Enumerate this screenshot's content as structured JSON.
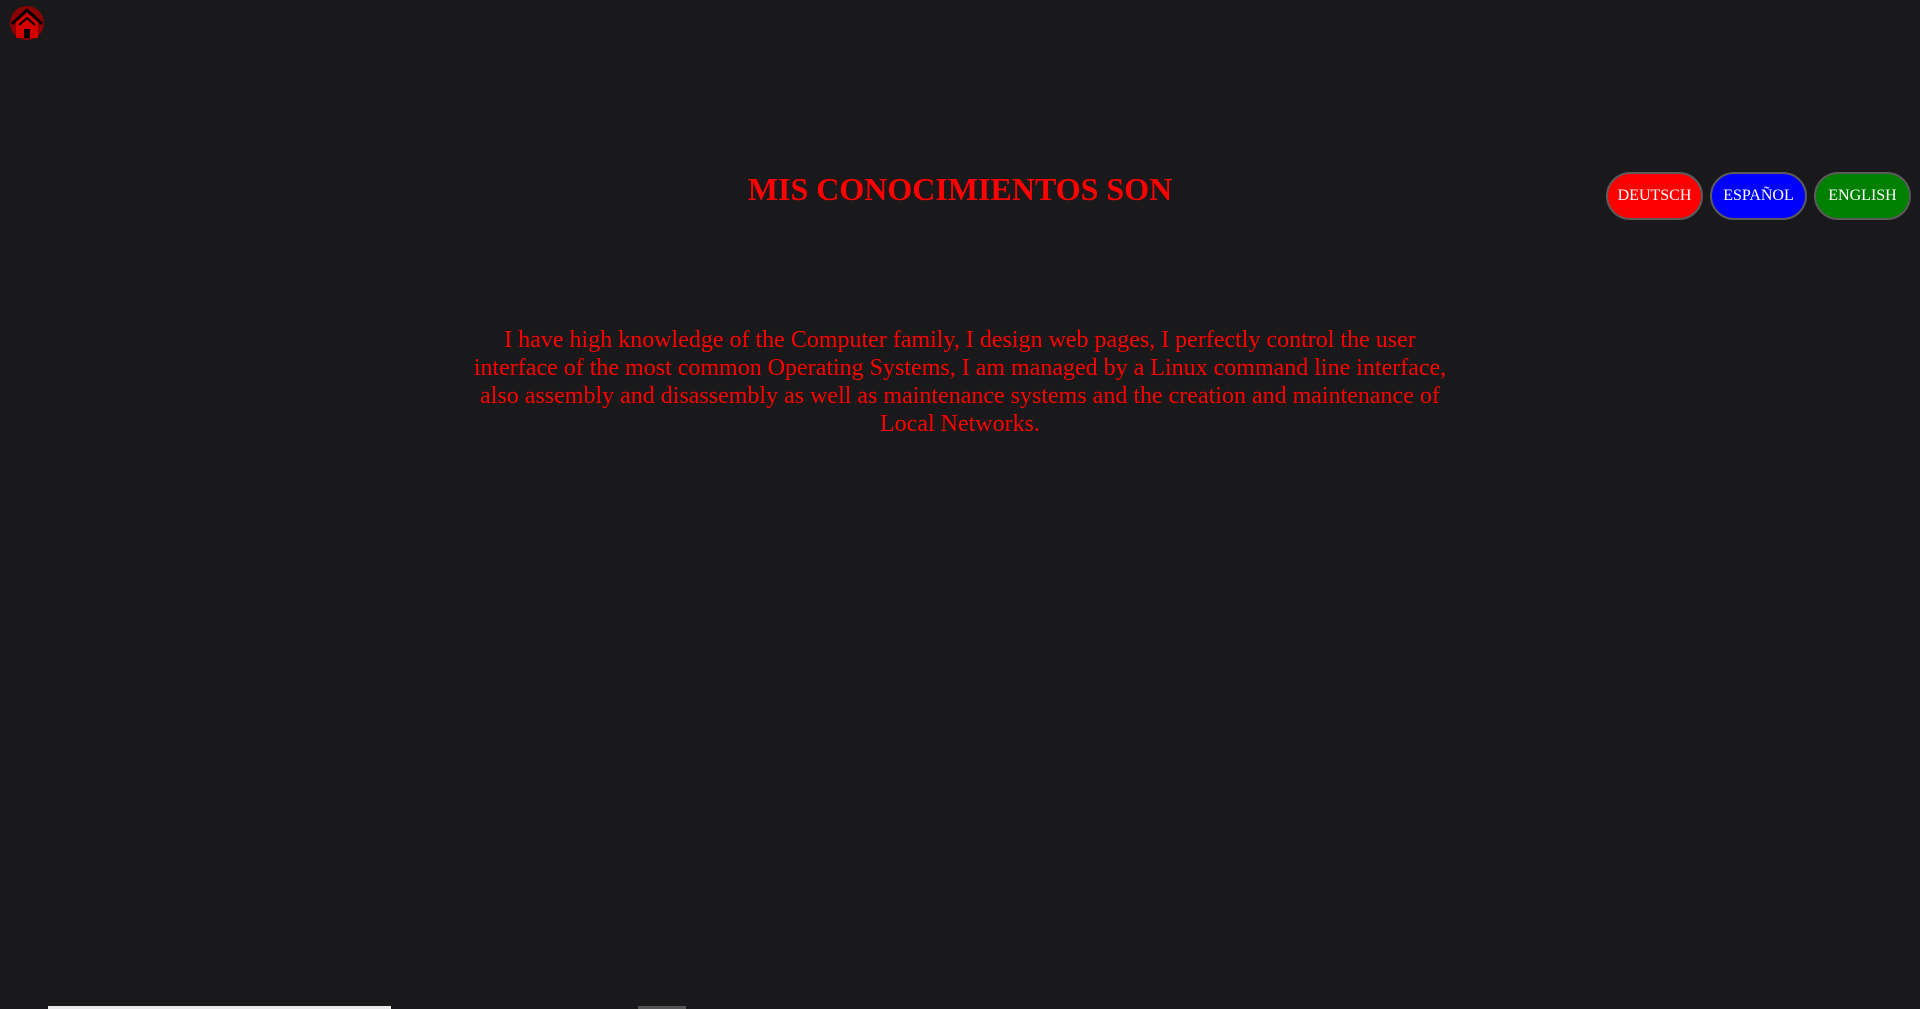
{
  "header": {
    "home_icon": "home-icon",
    "title": "MIS CONOCIMIENTOS SON"
  },
  "languages": {
    "deutsch": {
      "label": "DEUTSCH",
      "color": "#ff0000"
    },
    "espanol": {
      "label": "ESPAÑOL",
      "color": "#0000ff"
    },
    "english": {
      "label": "ENGLISH",
      "color": "#008000"
    }
  },
  "main": {
    "description": "I have high knowledge of the Computer family, I design web pages, I perfectly control the user interface of the most common Operating Systems, I am managed by a Linux command line interface, also assembly and disassembly as well as maintenance systems and the creation and maintenance of Local Networks."
  },
  "colors": {
    "background": "#19181a",
    "accent": "#ff0000"
  }
}
